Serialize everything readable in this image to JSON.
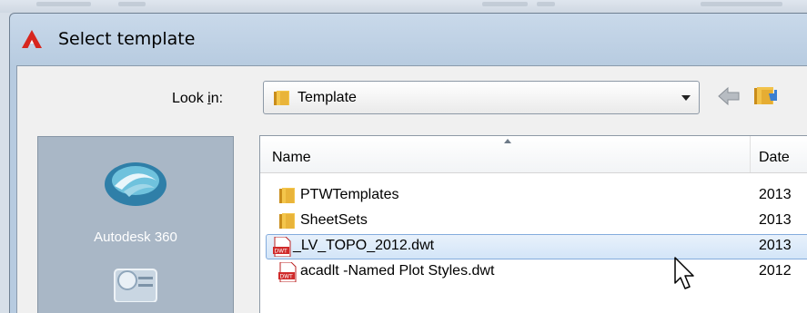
{
  "dialog": {
    "title": "Select template"
  },
  "lookin": {
    "label_pre": "Look ",
    "label_accel": "i",
    "label_post": "n:",
    "value": "Template"
  },
  "places": {
    "items": [
      {
        "label": "Autodesk 360",
        "icon": "autodesk-360-icon"
      },
      {
        "label": "",
        "icon": "history-icon"
      }
    ]
  },
  "columns": {
    "name": "Name",
    "date": "Date"
  },
  "files": [
    {
      "name": "PTWTemplates",
      "type": "folder",
      "date": "2013"
    },
    {
      "name": "SheetSets",
      "type": "folder",
      "date": "2013"
    },
    {
      "name": "_LV_TOPO_2012.dwt",
      "type": "dwt",
      "date": "2013",
      "selected": true
    },
    {
      "name": "acadlt -Named Plot Styles.dwt",
      "type": "dwt",
      "date": "2012"
    }
  ],
  "colors": {
    "selection_border": "#84acdd",
    "places_bg": "#a9b7c6",
    "folder": "#e8b43a",
    "dwt_icon": "#d02a2a"
  }
}
